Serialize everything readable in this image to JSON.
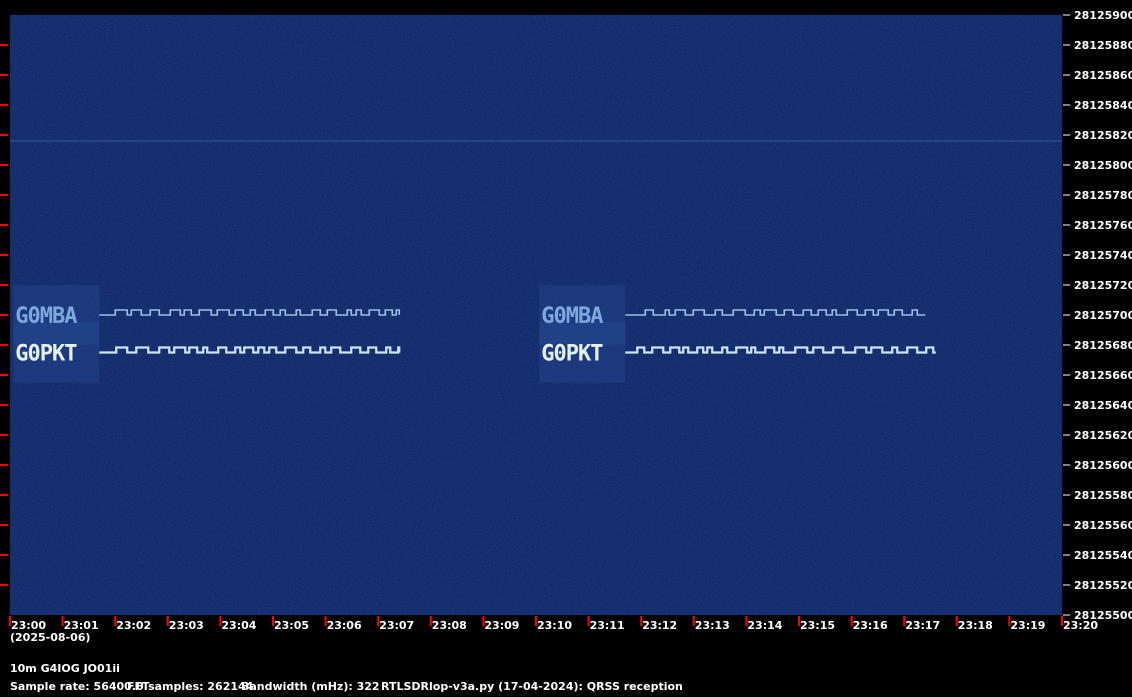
{
  "chart_data": {
    "type": "heatmap",
    "xlabel": "",
    "ylabel": "",
    "x_ticks": [
      "23:00",
      "23:01",
      "23:02",
      "23:03",
      "23:04",
      "23:05",
      "23:06",
      "23:07",
      "23:08",
      "23:09",
      "23:10",
      "23:11",
      "23:12",
      "23:13",
      "23:14",
      "23:15",
      "23:16",
      "23:17",
      "23:18",
      "23:19",
      "23:20"
    ],
    "x_date": "(2025-08-06)",
    "y_ticks": [
      28125500,
      28125520,
      28125540,
      28125560,
      28125580,
      28125600,
      28125620,
      28125640,
      28125660,
      28125680,
      28125700,
      28125720,
      28125740,
      28125760,
      28125780,
      28125800,
      28125820,
      28125840,
      28125860,
      28125880,
      28125900
    ],
    "ylim": [
      28125500,
      28125900
    ],
    "xlim_minutes": [
      0,
      20
    ],
    "signals": [
      {
        "text": "G0MBA",
        "freq": 28125700,
        "start_min": 0.1,
        "end_min": 7.4
      },
      {
        "text": "G0PKT",
        "freq": 28125675,
        "start_min": 0.1,
        "end_min": 7.4
      },
      {
        "text": "G0MBA",
        "freq": 28125700,
        "start_min": 10.1,
        "end_min": 17.4
      },
      {
        "text": "G0PKT",
        "freq": 28125675,
        "start_min": 10.1,
        "end_min": 17.6
      }
    ],
    "colors": {
      "background": "#0b1f5c",
      "signal": "#cfe4ff",
      "tick": "#ff0000"
    }
  },
  "footer": {
    "station": "10m G4IOG JO01ii",
    "sample_rate": "Sample rate: 56400.0",
    "fft_samples": "FFTsamples: 262144",
    "bandwidth": "Bandwidth (mHz): 322",
    "software": "RTLSDRlop-v3a.py (17-04-2024): QRSS reception"
  }
}
